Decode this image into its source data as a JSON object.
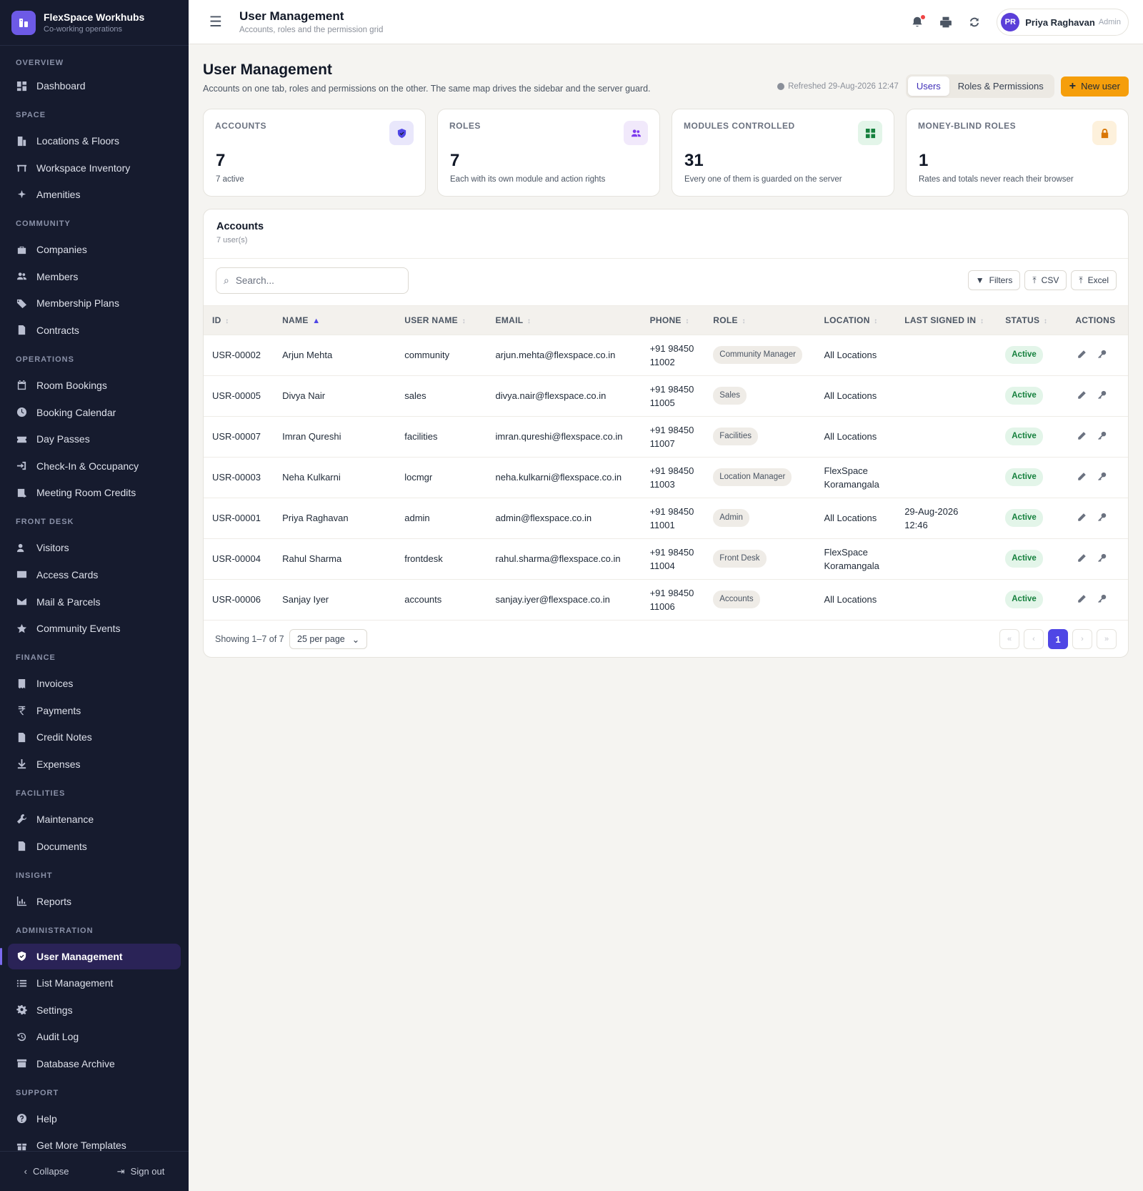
{
  "brand": {
    "name": "FlexSpace Workhubs",
    "subtitle": "Co-working operations"
  },
  "sidebar": {
    "sections": [
      {
        "title": "OVERVIEW",
        "items": [
          {
            "label": "Dashboard",
            "icon": "dashboard-icon"
          }
        ]
      },
      {
        "title": "SPACE",
        "items": [
          {
            "label": "Locations & Floors",
            "icon": "building-icon"
          },
          {
            "label": "Workspace Inventory",
            "icon": "desk-icon"
          },
          {
            "label": "Amenities",
            "icon": "sparkle-icon"
          }
        ]
      },
      {
        "title": "COMMUNITY",
        "items": [
          {
            "label": "Companies",
            "icon": "briefcase-icon"
          },
          {
            "label": "Members",
            "icon": "users-icon"
          },
          {
            "label": "Membership Plans",
            "icon": "tag-icon"
          },
          {
            "label": "Contracts",
            "icon": "document-icon"
          }
        ]
      },
      {
        "title": "OPERATIONS",
        "items": [
          {
            "label": "Room Bookings",
            "icon": "calendar-icon"
          },
          {
            "label": "Booking Calendar",
            "icon": "clock-icon"
          },
          {
            "label": "Day Passes",
            "icon": "ticket-icon"
          },
          {
            "label": "Check-In & Occupancy",
            "icon": "sign-in-icon"
          },
          {
            "label": "Meeting Room Credits",
            "icon": "credit-icon"
          }
        ]
      },
      {
        "title": "FRONT DESK",
        "items": [
          {
            "label": "Visitors",
            "icon": "visitor-icon"
          },
          {
            "label": "Access Cards",
            "icon": "card-icon"
          },
          {
            "label": "Mail & Parcels",
            "icon": "mail-icon"
          },
          {
            "label": "Community Events",
            "icon": "star-icon"
          }
        ]
      },
      {
        "title": "FINANCE",
        "items": [
          {
            "label": "Invoices",
            "icon": "invoice-icon"
          },
          {
            "label": "Payments",
            "icon": "rupee-icon"
          },
          {
            "label": "Credit Notes",
            "icon": "document-icon"
          },
          {
            "label": "Expenses",
            "icon": "download-icon"
          }
        ]
      },
      {
        "title": "FACILITIES",
        "items": [
          {
            "label": "Maintenance",
            "icon": "wrench-icon"
          },
          {
            "label": "Documents",
            "icon": "document-icon"
          }
        ]
      },
      {
        "title": "INSIGHT",
        "items": [
          {
            "label": "Reports",
            "icon": "bar-chart-icon"
          }
        ]
      },
      {
        "title": "ADMINISTRATION",
        "items": [
          {
            "label": "User Management",
            "icon": "shield-icon",
            "active": true
          },
          {
            "label": "List Management",
            "icon": "list-icon"
          },
          {
            "label": "Settings",
            "icon": "gear-icon"
          },
          {
            "label": "Audit Log",
            "icon": "history-icon"
          },
          {
            "label": "Database Archive",
            "icon": "archive-icon"
          }
        ]
      },
      {
        "title": "SUPPORT",
        "items": [
          {
            "label": "Help",
            "icon": "help-icon"
          },
          {
            "label": "Get More Templates",
            "icon": "gift-icon"
          }
        ]
      }
    ],
    "collapse_label": "Collapse",
    "signout_label": "Sign out"
  },
  "topbar": {
    "title": "User Management",
    "subtitle": "Accounts, roles and the permission grid",
    "user": {
      "initials": "PR",
      "name": "Priya Raghavan",
      "role": "Admin"
    }
  },
  "page": {
    "title": "User Management",
    "description": "Accounts on one tab, roles and permissions on the other. The same map drives the sidebar and the server guard.",
    "refreshed": "Refreshed 29-Aug-2026 12:47",
    "tabs": [
      "Users",
      "Roles & Permissions"
    ],
    "active_tab": "Users",
    "new_button": "New user"
  },
  "stats": [
    {
      "label": "ACCOUNTS",
      "value": "7",
      "note": "7 active",
      "icon": "shield-icon",
      "icon_bg": "#e9e7fb",
      "icon_color": "#4f46e5"
    },
    {
      "label": "ROLES",
      "value": "7",
      "note": "Each with its own module and action rights",
      "icon": "users-icon",
      "icon_bg": "#f1e9fb",
      "icon_color": "#7c3aed"
    },
    {
      "label": "MODULES CONTROLLED",
      "value": "31",
      "note": "Every one of them is guarded on the server",
      "icon": "grid-icon",
      "icon_bg": "#e3f5e9",
      "icon_color": "#15803d"
    },
    {
      "label": "MONEY-BLIND ROLES",
      "value": "1",
      "note": "Rates and totals never reach their browser",
      "icon": "lock-icon",
      "icon_bg": "#fdf1dc",
      "icon_color": "#d97706"
    }
  ],
  "accounts": {
    "title": "Accounts",
    "subtitle": "7 user(s)",
    "search_placeholder": "Search...",
    "toolbar": [
      "Filters",
      "CSV",
      "Excel"
    ],
    "columns": [
      "ID",
      "NAME",
      "USER NAME",
      "EMAIL",
      "PHONE",
      "ROLE",
      "LOCATION",
      "LAST SIGNED IN",
      "STATUS",
      "ACTIONS"
    ],
    "sorted_column": "NAME",
    "rows": [
      {
        "id": "USR-00002",
        "name": "Arjun Mehta",
        "username": "community",
        "email": "arjun.mehta@flexspace.co.in",
        "phone": [
          "+91 98450",
          "11002"
        ],
        "role": "Community Manager",
        "location": [
          "All Locations"
        ],
        "last_signed_in": [],
        "status": "Active"
      },
      {
        "id": "USR-00005",
        "name": "Divya Nair",
        "username": "sales",
        "email": "divya.nair@flexspace.co.in",
        "phone": [
          "+91 98450",
          "11005"
        ],
        "role": "Sales",
        "location": [
          "All Locations"
        ],
        "last_signed_in": [],
        "status": "Active"
      },
      {
        "id": "USR-00007",
        "name": "Imran Qureshi",
        "username": "facilities",
        "email": "imran.qureshi@flexspace.co.in",
        "phone": [
          "+91 98450",
          "11007"
        ],
        "role": "Facilities",
        "location": [
          "All Locations"
        ],
        "last_signed_in": [],
        "status": "Active"
      },
      {
        "id": "USR-00003",
        "name": "Neha Kulkarni",
        "username": "locmgr",
        "email": "neha.kulkarni@flexspace.co.in",
        "phone": [
          "+91 98450",
          "11003"
        ],
        "role": "Location Manager",
        "location": [
          "FlexSpace",
          "Koramangala"
        ],
        "last_signed_in": [],
        "status": "Active"
      },
      {
        "id": "USR-00001",
        "name": "Priya Raghavan",
        "username": "admin",
        "email": "admin@flexspace.co.in",
        "phone": [
          "+91 98450",
          "11001"
        ],
        "role": "Admin",
        "location": [
          "All Locations"
        ],
        "last_signed_in": [
          "29-Aug-2026",
          "12:46"
        ],
        "status": "Active"
      },
      {
        "id": "USR-00004",
        "name": "Rahul Sharma",
        "username": "frontdesk",
        "email": "rahul.sharma@flexspace.co.in",
        "phone": [
          "+91 98450",
          "11004"
        ],
        "role": "Front Desk",
        "location": [
          "FlexSpace",
          "Koramangala"
        ],
        "last_signed_in": [],
        "status": "Active"
      },
      {
        "id": "USR-00006",
        "name": "Sanjay Iyer",
        "username": "accounts",
        "email": "sanjay.iyer@flexspace.co.in",
        "phone": [
          "+91 98450",
          "11006"
        ],
        "role": "Accounts",
        "location": [
          "All Locations"
        ],
        "last_signed_in": [],
        "status": "Active"
      }
    ],
    "showing": "Showing 1–7 of 7",
    "per_page": "25 per page",
    "pager": [
      "«",
      "‹",
      "1",
      "›",
      "»"
    ],
    "current_page": "1"
  }
}
